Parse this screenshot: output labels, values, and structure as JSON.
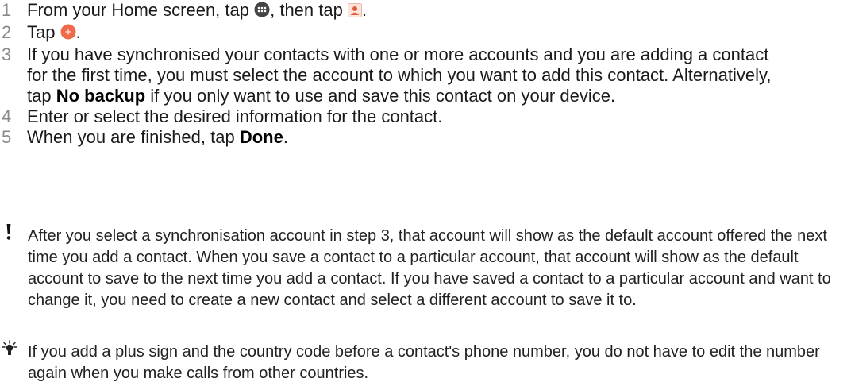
{
  "steps": [
    {
      "num": "1",
      "text_a": "From your Home screen, tap ",
      "text_b": ", then tap ",
      "text_c": "."
    },
    {
      "num": "2",
      "text_a": "Tap ",
      "text_b": "."
    },
    {
      "num": "3",
      "text_a": "If you have synchronised your contacts with one or more accounts and you are adding a contact for the first time, you must select the account to which you want to add this contact. Alternatively, tap ",
      "bold": "No backup",
      "text_b": " if you only want to use and save this contact on your device."
    },
    {
      "num": "4",
      "text_a": "Enter or select the desired information for the contact."
    },
    {
      "num": "5",
      "text_a": "When you are finished, tap ",
      "bold": "Done",
      "text_b": "."
    }
  ],
  "notes": {
    "warning": "After you select a synchronisation account in step 3, that account will show as the default account offered the next time you add a contact. When you save a contact to a particular account, that account will show as the default account to save to the next time you add a contact. If you have saved a contact to a particular account and want to change it, you need to create a new contact and select a different account to save it to.",
    "tip": "If you add a plus sign and the country code before a contact's phone number, you do not have to edit the number again when you make calls from other countries."
  },
  "colors": {
    "step_number": "#8a8a8a",
    "add_button": "#ee6a4a",
    "apps_icon": "#444444",
    "contacts_icon": "#e35b3b"
  },
  "icons": [
    "apps-icon",
    "contacts-app-icon",
    "add-contact-icon",
    "warning-icon",
    "tip-icon"
  ]
}
